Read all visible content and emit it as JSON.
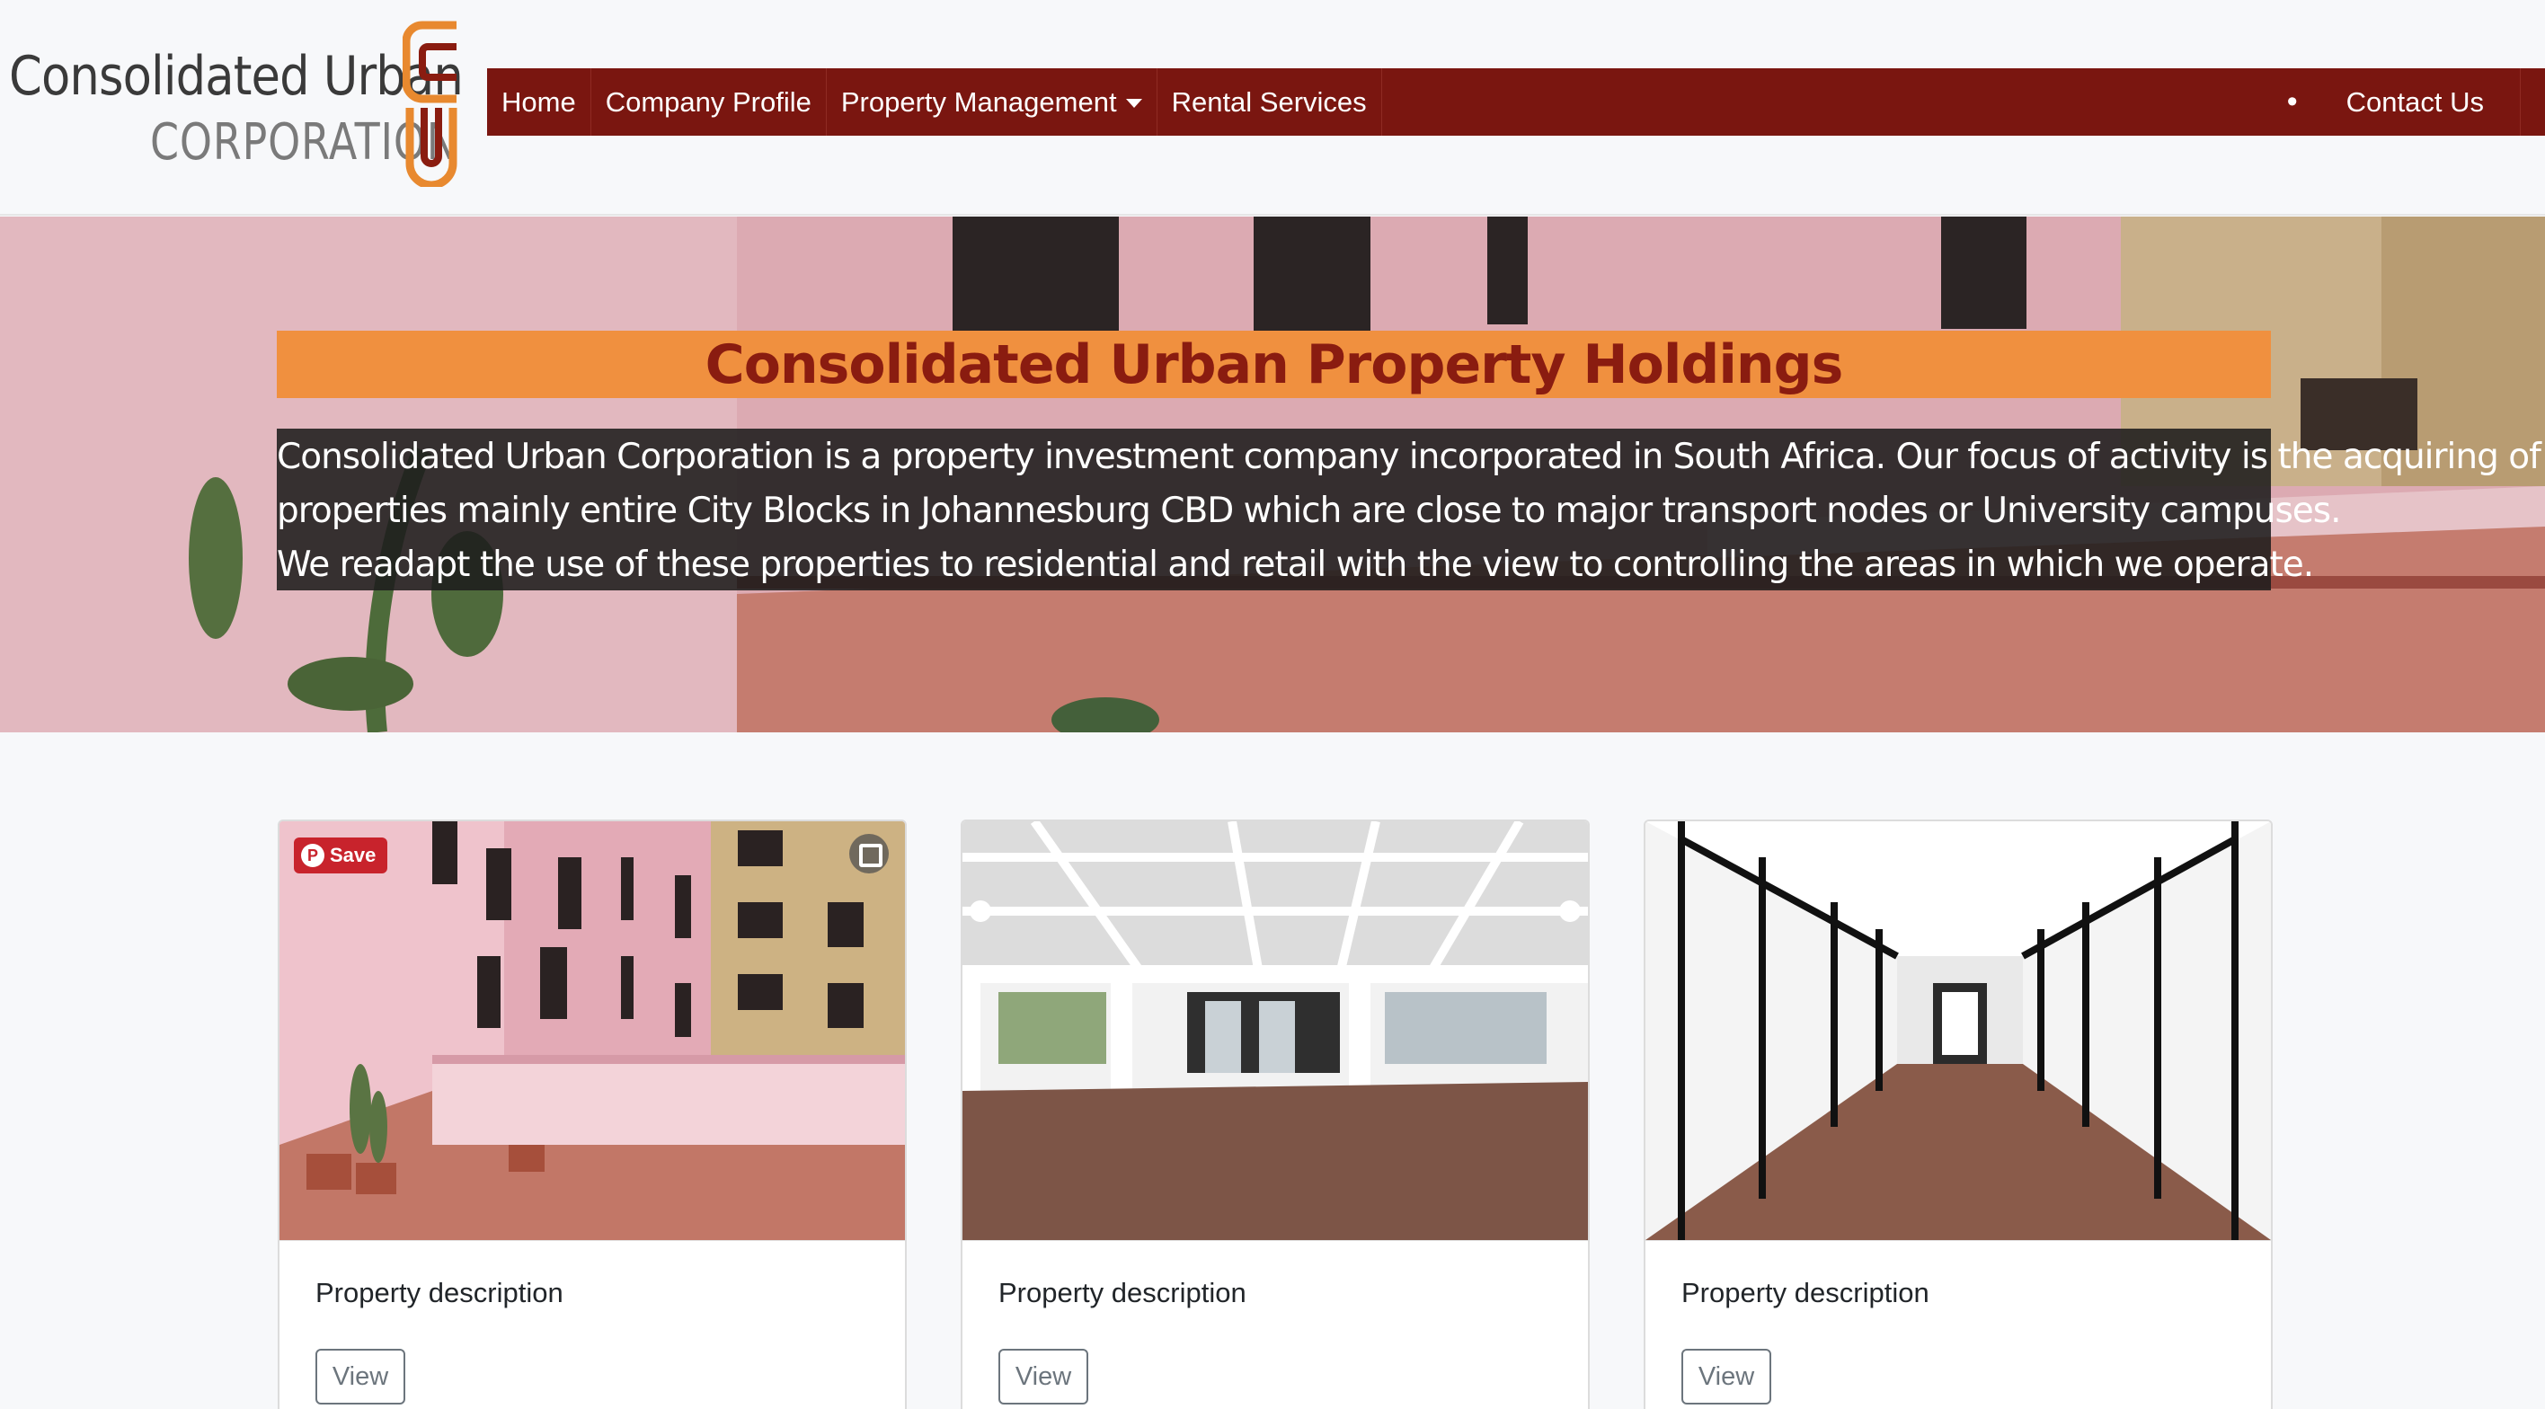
{
  "logo": {
    "line1": "Consolidated Urban",
    "line2": "CORPORATION",
    "accent_color": "#e8892f"
  },
  "nav": {
    "items": [
      {
        "label": "Home"
      },
      {
        "label": "Company Profile"
      },
      {
        "label": "Property Management",
        "dropdown": true
      },
      {
        "label": "Rental Services"
      }
    ],
    "dot": "•",
    "contact": "Contact Us",
    "bg_color": "#7a1610"
  },
  "hero": {
    "title": "Consolidated Urban Property Holdings",
    "description_lines": [
      "Consolidated Urban Corporation is a property investment company incorporated in South Africa. Our focus of activity is the acquiring of",
      "properties mainly entire City Blocks in Johannesburg CBD which are close to major transport nodes or University campuses.",
      "We readapt the use of these properties to residential and retail with the view to controlling the areas in which we operate."
    ],
    "title_band_color": "#f0903f",
    "title_color": "#8a1c10"
  },
  "cards": [
    {
      "text": "Property description",
      "button": "View",
      "save_label": "Save"
    },
    {
      "text": "Property description",
      "button": "View"
    },
    {
      "text": "Property description",
      "button": "View"
    }
  ]
}
